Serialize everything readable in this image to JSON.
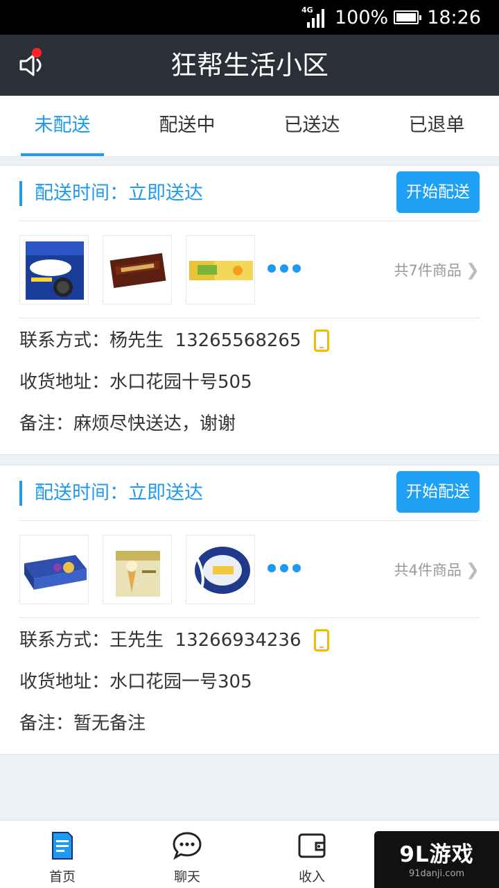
{
  "status_bar": {
    "network": "4G",
    "battery": "100%",
    "time": "18:26"
  },
  "header": {
    "title": "狂帮生活小区",
    "left_icon": "speaker-icon"
  },
  "tabs": [
    {
      "label": "未配送",
      "active": true
    },
    {
      "label": "配送中",
      "active": false
    },
    {
      "label": "已送达",
      "active": false
    },
    {
      "label": "已退单",
      "active": false
    }
  ],
  "orders": [
    {
      "delivery_time": "配送时间：立即送达",
      "action_label": "开始配送",
      "goods_count": "共7件商品",
      "contact": "联系方式：杨先生  13265568265",
      "address": "收货地址：水口花园十号505",
      "note": "备注：麻烦尽快送达，谢谢"
    },
    {
      "delivery_time": "配送时间：立即送达",
      "action_label": "开始配送",
      "goods_count": "共4件商品",
      "contact": "联系方式：王先生  13266934236",
      "address": "收货地址：水口花园一号305",
      "note": "备注：暂无备注"
    }
  ],
  "bottom_nav": [
    {
      "label": "首页",
      "icon": "document-icon"
    },
    {
      "label": "聊天",
      "icon": "chat-icon"
    },
    {
      "label": "收入",
      "icon": "wallet-icon"
    },
    {
      "label": "",
      "icon": "user-icon"
    }
  ],
  "watermark": {
    "brand": "9L游戏",
    "site": "91danji.com"
  },
  "colors": {
    "accent": "#1e9af0",
    "header_bg": "#2b2f38",
    "phone_icon": "#f5b800",
    "badge": "#ff2222"
  }
}
